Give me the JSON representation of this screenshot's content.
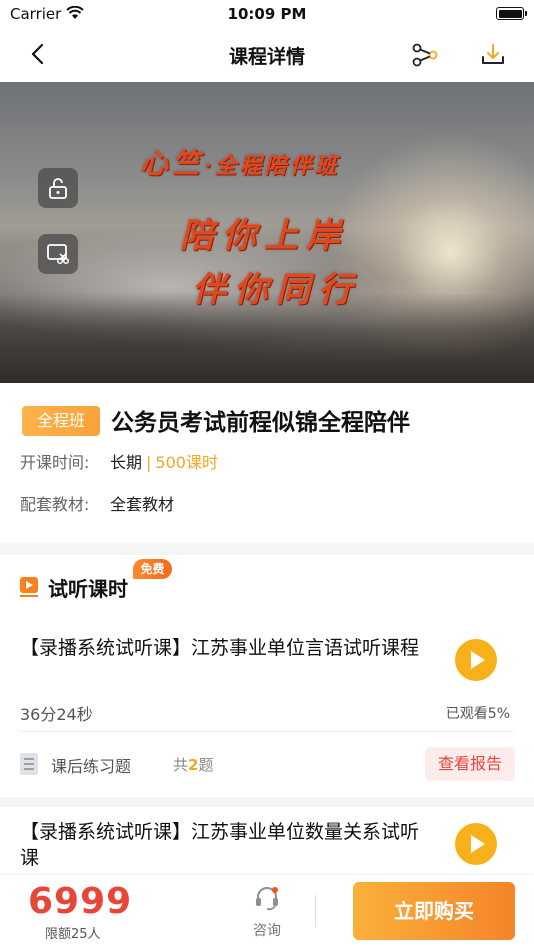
{
  "status_bar": {
    "carrier": "Carrier",
    "time": "10:09 PM"
  },
  "nav": {
    "title": "课程详情"
  },
  "video": {
    "line1_main": "心竺",
    "line1_sub": "·全程陪伴班",
    "line2": "陪你上岸",
    "line3": "伴你同行"
  },
  "course": {
    "tag": "全程班",
    "title": "公务员考试前程似锦全程陪伴",
    "start_label": "开课时间:",
    "start_value": "长期",
    "separator": "|",
    "hours": "500课时",
    "material_label": "配套教材:",
    "material_value": "全套教材"
  },
  "trial_section": {
    "title": "试听课时",
    "badge": "免费",
    "lessons": [
      {
        "title": "【录播系统试听课】江苏事业单位言语试听课程",
        "duration": "36分24秒",
        "watched": "已观看5%",
        "exercise_label": "课后练习题",
        "count_prefix": "共",
        "count_num": "2",
        "count_suffix": "题",
        "report_label": "查看报告"
      },
      {
        "title": "【录播系统试听课】江苏事业单位数量关系试听课"
      }
    ]
  },
  "bottom_bar": {
    "price": "6999",
    "limit": "限额25人",
    "consult_label": "咨询",
    "buy_label": "立即购买"
  },
  "colors": {
    "accent_orange": "#f5a623",
    "price_red": "#e9463a",
    "play_yellow": "#f7b21b"
  }
}
